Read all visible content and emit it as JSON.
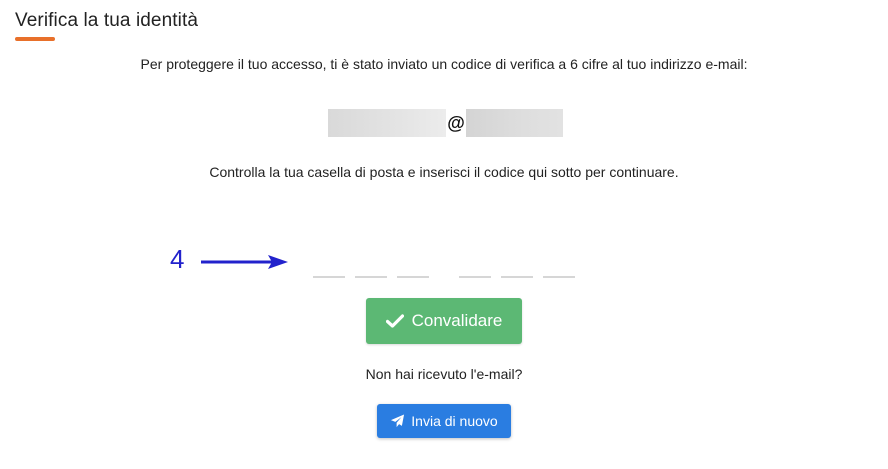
{
  "header": {
    "title": "Verifica la tua identità",
    "accent_color": "#e8702a"
  },
  "intro": {
    "text": "Per proteggere il tuo accesso, ti è stato inviato un codice di verifica a 6 cifre al tuo indirizzo e-mail:"
  },
  "email": {
    "at_symbol": "@",
    "local_part_redacted": true,
    "domain_redacted": true
  },
  "instructions": {
    "text": "Controlla la tua casella di posta e inserisci il codice qui sotto per continuare."
  },
  "annotation": {
    "number": "4",
    "color": "#2222cc",
    "icon": "arrow-right-icon"
  },
  "code_inputs": {
    "count": 6,
    "values": [
      "",
      "",
      "",
      "",
      "",
      ""
    ]
  },
  "validate_button": {
    "label": "Convalidare",
    "icon": "check-icon",
    "color": "#5cb874"
  },
  "resend": {
    "prompt": "Non hai ricevuto l'e-mail?",
    "button_label": "Invia di nuovo",
    "icon": "paper-plane-icon",
    "color": "#2a7de1"
  }
}
